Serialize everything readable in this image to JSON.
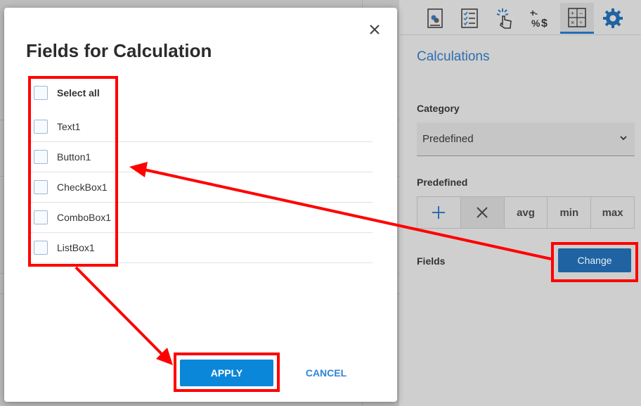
{
  "dialog": {
    "title": "Fields for Calculation",
    "select_all_label": "Select all",
    "fields": [
      {
        "label": "Text1",
        "checked": false
      },
      {
        "label": "Button1",
        "checked": false
      },
      {
        "label": "CheckBox1",
        "checked": false
      },
      {
        "label": "ComboBox1",
        "checked": false
      },
      {
        "label": "ListBox1",
        "checked": false
      }
    ],
    "apply_label": "APPLY",
    "cancel_label": "CANCEL"
  },
  "panel": {
    "title": "Calculations",
    "category_label": "Category",
    "category_value": "Predefined",
    "predefined_label": "Predefined",
    "operations": [
      "avg",
      "min",
      "max"
    ],
    "fields_label": "Fields",
    "change_label": "Change",
    "toolbar_icons": [
      "data-icon",
      "checklist-icon",
      "click-action-icon",
      "format-icon",
      "calculator-icon",
      "gear-icon"
    ],
    "toolbar_active": "calculator-icon"
  },
  "colors": {
    "accent": "#2e6eb0",
    "apply": "#0a87d9",
    "annotation": "#ff0000"
  }
}
